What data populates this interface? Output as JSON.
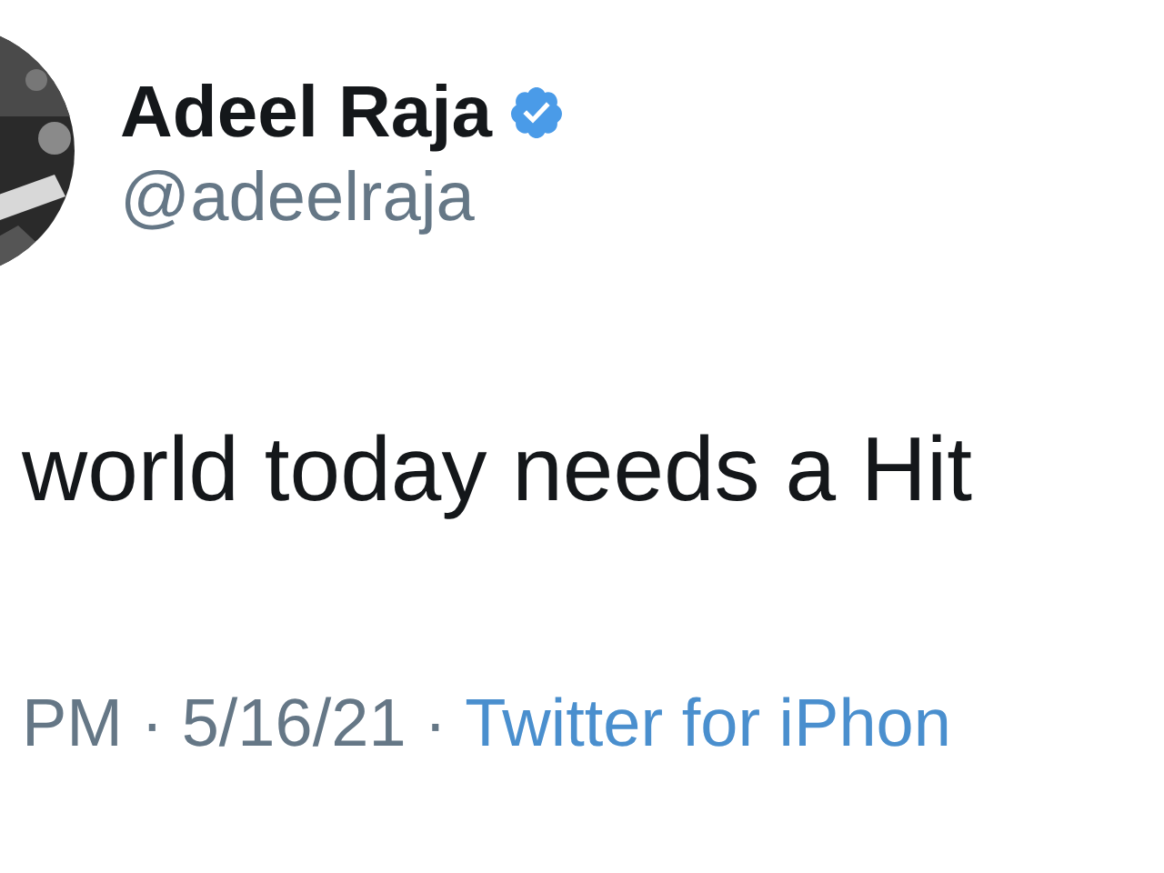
{
  "author": {
    "name": "Adeel Raja",
    "verified": true,
    "handle": "@adeelraja"
  },
  "tweet": {
    "text": "world today needs a Hit"
  },
  "footer": {
    "time": "PM",
    "separator_1": "·",
    "date": "5/16/21",
    "separator_2": "·",
    "source": "Twitter for iPhon"
  }
}
